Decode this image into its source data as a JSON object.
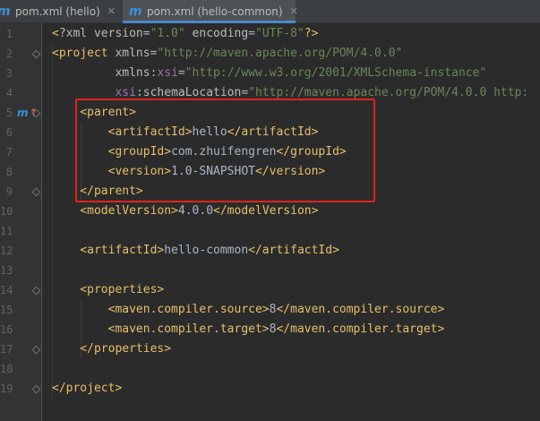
{
  "tabs": [
    {
      "label": "pom.xml (hello)",
      "icon": "maven-m-icon",
      "active": false
    },
    {
      "label": "pom.xml (hello-common)",
      "icon": "maven-m-icon",
      "active": true
    }
  ],
  "close_glyph": "✕",
  "icon_glyph": "m",
  "override_arrow": "↑",
  "line_numbers": [
    "1",
    "2",
    "3",
    "4",
    "5",
    "6",
    "7",
    "8",
    "9",
    "10",
    "11",
    "12",
    "13",
    "14",
    "15",
    "16",
    "17",
    "18",
    "19"
  ],
  "code_lines": [
    [
      {
        "t": "<",
        "c": "br"
      },
      {
        "t": "?xml version",
        "c": "attr"
      },
      {
        "t": "=",
        "c": "text"
      },
      {
        "t": "\"1.0\"",
        "c": "str"
      },
      {
        "t": " encoding",
        "c": "attr"
      },
      {
        "t": "=",
        "c": "text"
      },
      {
        "t": "\"UTF-8\"",
        "c": "str"
      },
      {
        "t": "?>",
        "c": "br"
      }
    ],
    [
      {
        "t": "<project ",
        "c": "br"
      },
      {
        "t": "xmlns",
        "c": "attr"
      },
      {
        "t": "=",
        "c": "text"
      },
      {
        "t": "\"http://maven.apache.org/POM/4.0.0\"",
        "c": "str"
      }
    ],
    [
      {
        "t": "         ",
        "c": "text"
      },
      {
        "t": "xmlns",
        "c": "attr"
      },
      {
        "t": ":",
        "c": "text"
      },
      {
        "t": "xsi",
        "c": "ns"
      },
      {
        "t": "=",
        "c": "text"
      },
      {
        "t": "\"http://www.w3.org/2001/XMLSchema-instance\"",
        "c": "str"
      }
    ],
    [
      {
        "t": "         ",
        "c": "text"
      },
      {
        "t": "xsi",
        "c": "ns"
      },
      {
        "t": ":",
        "c": "text"
      },
      {
        "t": "schemaLocation",
        "c": "attr"
      },
      {
        "t": "=",
        "c": "text"
      },
      {
        "t": "\"http://maven.apache.org/POM/4.0.0 http:",
        "c": "str"
      }
    ],
    [
      {
        "t": "    <parent>",
        "c": "br"
      }
    ],
    [
      {
        "t": "        <artifactId>",
        "c": "br"
      },
      {
        "t": "hello",
        "c": "text"
      },
      {
        "t": "</artifactId>",
        "c": "br"
      }
    ],
    [
      {
        "t": "        <groupId>",
        "c": "br"
      },
      {
        "t": "com.zhuifengren",
        "c": "text"
      },
      {
        "t": "</groupId>",
        "c": "br"
      }
    ],
    [
      {
        "t": "        <version>",
        "c": "br"
      },
      {
        "t": "1.0-SNAPSHOT",
        "c": "text"
      },
      {
        "t": "</version>",
        "c": "br"
      }
    ],
    [
      {
        "t": "    </parent>",
        "c": "br"
      }
    ],
    [
      {
        "t": "    <modelVersion>",
        "c": "br"
      },
      {
        "t": "4.0.0",
        "c": "text"
      },
      {
        "t": "</modelVersion>",
        "c": "br"
      }
    ],
    [],
    [
      {
        "t": "    <artifactId>",
        "c": "br"
      },
      {
        "t": "hello-common",
        "c": "text"
      },
      {
        "t": "</artifactId>",
        "c": "br"
      }
    ],
    [],
    [
      {
        "t": "    <properties>",
        "c": "br"
      }
    ],
    [
      {
        "t": "        <maven.compiler.source>",
        "c": "br"
      },
      {
        "t": "8",
        "c": "text"
      },
      {
        "t": "</maven.compiler.source>",
        "c": "br"
      }
    ],
    [
      {
        "t": "        <maven.compiler.target>",
        "c": "br"
      },
      {
        "t": "8",
        "c": "text"
      },
      {
        "t": "</maven.compiler.target>",
        "c": "br"
      }
    ],
    [
      {
        "t": "    </properties>",
        "c": "br"
      }
    ],
    [],
    [
      {
        "t": "</project>",
        "c": "br"
      }
    ]
  ],
  "override_line": "5",
  "fold_lines": [
    "2",
    "5",
    "9",
    "14",
    "17",
    "19"
  ],
  "highlighted_lines": [
    "5",
    "9"
  ],
  "colors": {
    "background": "#2b2b2b",
    "gutter": "#313335",
    "tag": "#e8bf6a",
    "attribute": "#bababa",
    "string": "#6a8759",
    "namespace": "#9876aa",
    "text": "#a9b7c6",
    "highlight_border": "#e0231b",
    "maven_icon": "#3c8fd6"
  }
}
